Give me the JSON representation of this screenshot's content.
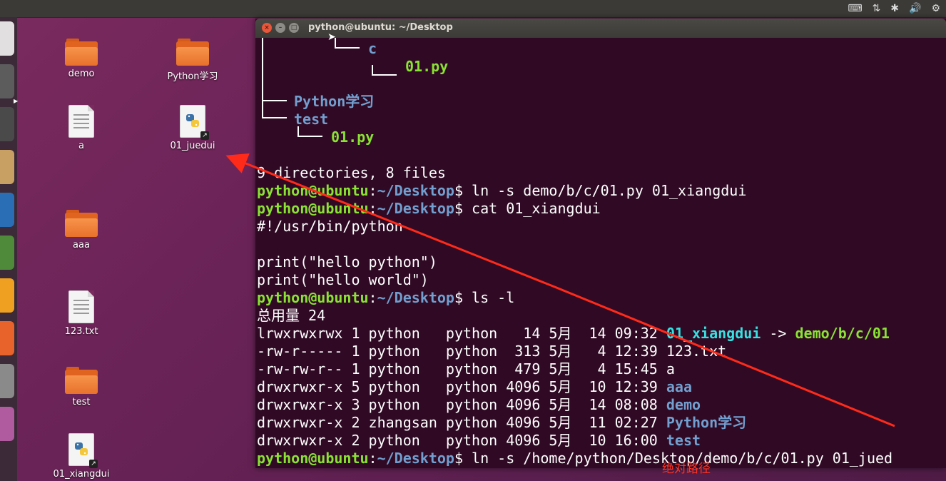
{
  "system_tray": {
    "icons": [
      "keyboard-icon",
      "network-icon",
      "bluetooth-icon",
      "volume-icon",
      "settings-gear-icon"
    ]
  },
  "desktop": {
    "icons": [
      {
        "label": "demo",
        "kind": "folder"
      },
      {
        "label": "Python学习",
        "kind": "folder"
      },
      {
        "label": "a",
        "kind": "file"
      },
      {
        "label": "01_juedui",
        "kind": "python-link"
      },
      {
        "label": "aaa",
        "kind": "folder"
      },
      {
        "label": "123.txt",
        "kind": "file"
      },
      {
        "label": "test",
        "kind": "folder"
      },
      {
        "label": "01_xiangdui",
        "kind": "python-link"
      }
    ]
  },
  "terminal": {
    "title": "python@ubuntu: ~/Desktop",
    "prompt_user": "python@ubuntu",
    "prompt_path": "~/Desktop",
    "tree": {
      "line1_dir": "c",
      "line2_file": "01.py",
      "line3_dir": "Python学习",
      "line4_dir": "test",
      "line5_file": "01.py",
      "summary": "9 directories, 8 files"
    },
    "cmd1": " ln -s demo/b/c/01.py 01_xiangdui",
    "cmd2": " cat 01_xiangdui",
    "cat_output": [
      "#!/usr/bin/python",
      "",
      "print(\"hello python\")",
      "print(\"hello world\")"
    ],
    "cmd3": " ls -l",
    "total": "总用量 24",
    "ls_rows": [
      {
        "meta": "lrwxrwxrwx 1 python   python   14 5月  14 09:32 ",
        "name": "01_xiangdui",
        "kind": "link",
        "target": "demo/b/c/01"
      },
      {
        "meta": "-rw-r----- 1 python   python  313 5月   4 12:39 ",
        "name": "123.txt",
        "kind": "file",
        "target": ""
      },
      {
        "meta": "-rw-rw-r-- 1 python   python  479 5月   4 15:45 ",
        "name": "a",
        "kind": "file",
        "target": ""
      },
      {
        "meta": "drwxrwxr-x 5 python   python 4096 5月  10 12:39 ",
        "name": "aaa",
        "kind": "dir",
        "target": ""
      },
      {
        "meta": "drwxrwxr-x 3 python   python 4096 5月  14 08:08 ",
        "name": "demo",
        "kind": "dir",
        "target": ""
      },
      {
        "meta": "drwxrwxr-x 2 zhangsan python 4096 5月  11 02:27 ",
        "name": "Python学习",
        "kind": "dir",
        "target": ""
      },
      {
        "meta": "drwxrwxr-x 2 python   python 4096 5月  10 16:00 ",
        "name": "test",
        "kind": "dir",
        "target": ""
      }
    ],
    "cmd4": " ln -s /home/python/Desktop/demo/b/c/01.py 01_jued",
    "link_arrow": " -> "
  },
  "annotation": {
    "text": "绝对路径",
    "color": "#ff3322"
  }
}
